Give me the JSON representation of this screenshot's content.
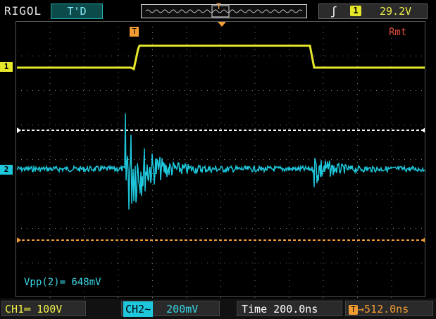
{
  "header": {
    "brand": "RIGOL",
    "run_status": "T'D",
    "timebase_marker": "T",
    "trigger": {
      "edge_icon": "rising-edge-icon",
      "source": "1",
      "level": "29.2V"
    }
  },
  "screen": {
    "remote_label": "Rmt",
    "trigger_marker": "T",
    "ch1_marker": "1",
    "ch2_marker": "2",
    "measurement": "Vpp(2)= 648mV"
  },
  "footer": {
    "ch1": "CH1═ 100V",
    "ch2_label": "CH2",
    "ch2_coupling": "~",
    "ch2_scale": "200mV",
    "time": "Time 200.0ns",
    "delay_icon": "T",
    "delay": "→512.0ns"
  },
  "colors": {
    "ch1": "#e7e72a",
    "ch2": "#1ec7dc",
    "trigger": "#f39c34",
    "grid": "#7a7a7a"
  }
}
